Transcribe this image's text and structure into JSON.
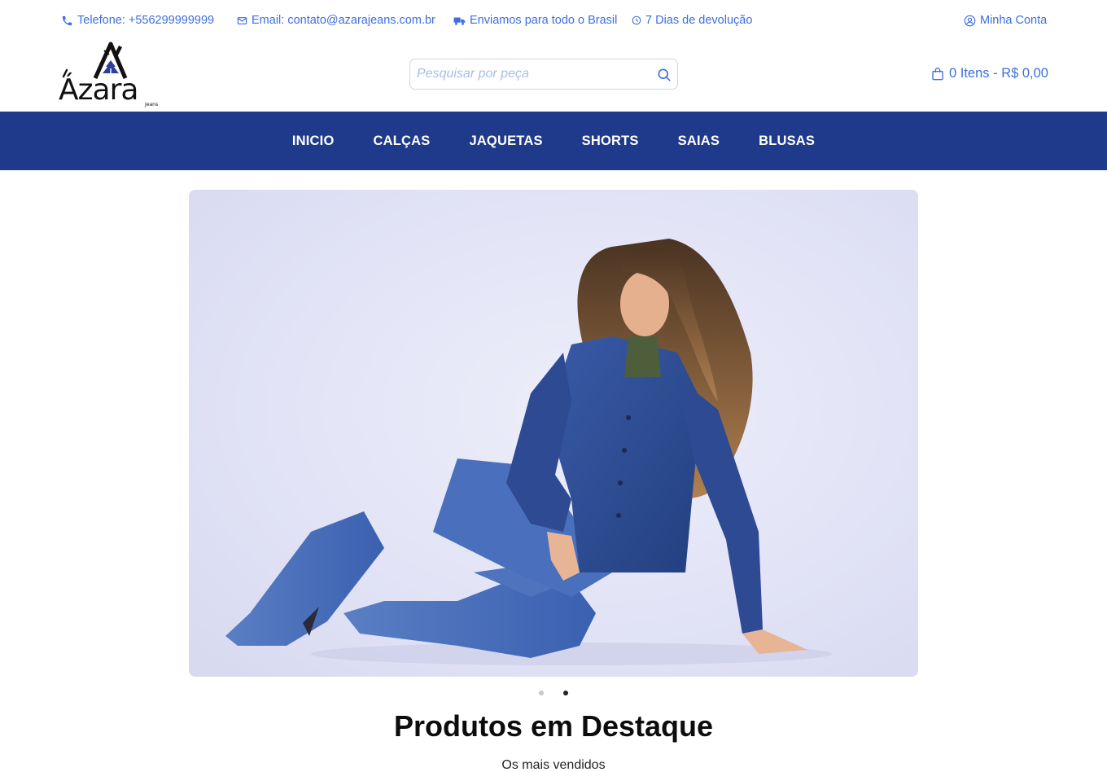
{
  "topbar": {
    "phone": "Telefone: +556299999999",
    "email": "Email: contato@azarajeans.com.br",
    "shipping": "Enviamos para todo o Brasil",
    "returns": "7 Dias de devolução",
    "account": "Minha Conta"
  },
  "brand": {
    "name": "Ázara",
    "tagline": "Jeans"
  },
  "search": {
    "placeholder": "Pesquisar por peça",
    "value": ""
  },
  "cart": {
    "label": "0 Itens - R$ 0,00"
  },
  "nav": {
    "items": [
      {
        "label": "INICIO"
      },
      {
        "label": "CALÇAS"
      },
      {
        "label": "JAQUETAS"
      },
      {
        "label": "SHORTS"
      },
      {
        "label": "SAIAS"
      },
      {
        "label": "BLUSAS"
      }
    ]
  },
  "carousel": {
    "slide_count": 2,
    "active_slide": 2
  },
  "featured": {
    "title": "Produtos em Destaque",
    "subtitle": "Os mais vendidos"
  },
  "colors": {
    "accent": "#3d6ee0",
    "navbar": "#1f3a8a",
    "denim": "#2f4f99"
  },
  "icons": {
    "phone": "phone-icon",
    "email": "envelope-icon",
    "shipping": "truck-icon",
    "returns": "clock-icon",
    "account": "user-circle-icon",
    "search": "search-icon",
    "cart": "shopping-bag-icon"
  }
}
